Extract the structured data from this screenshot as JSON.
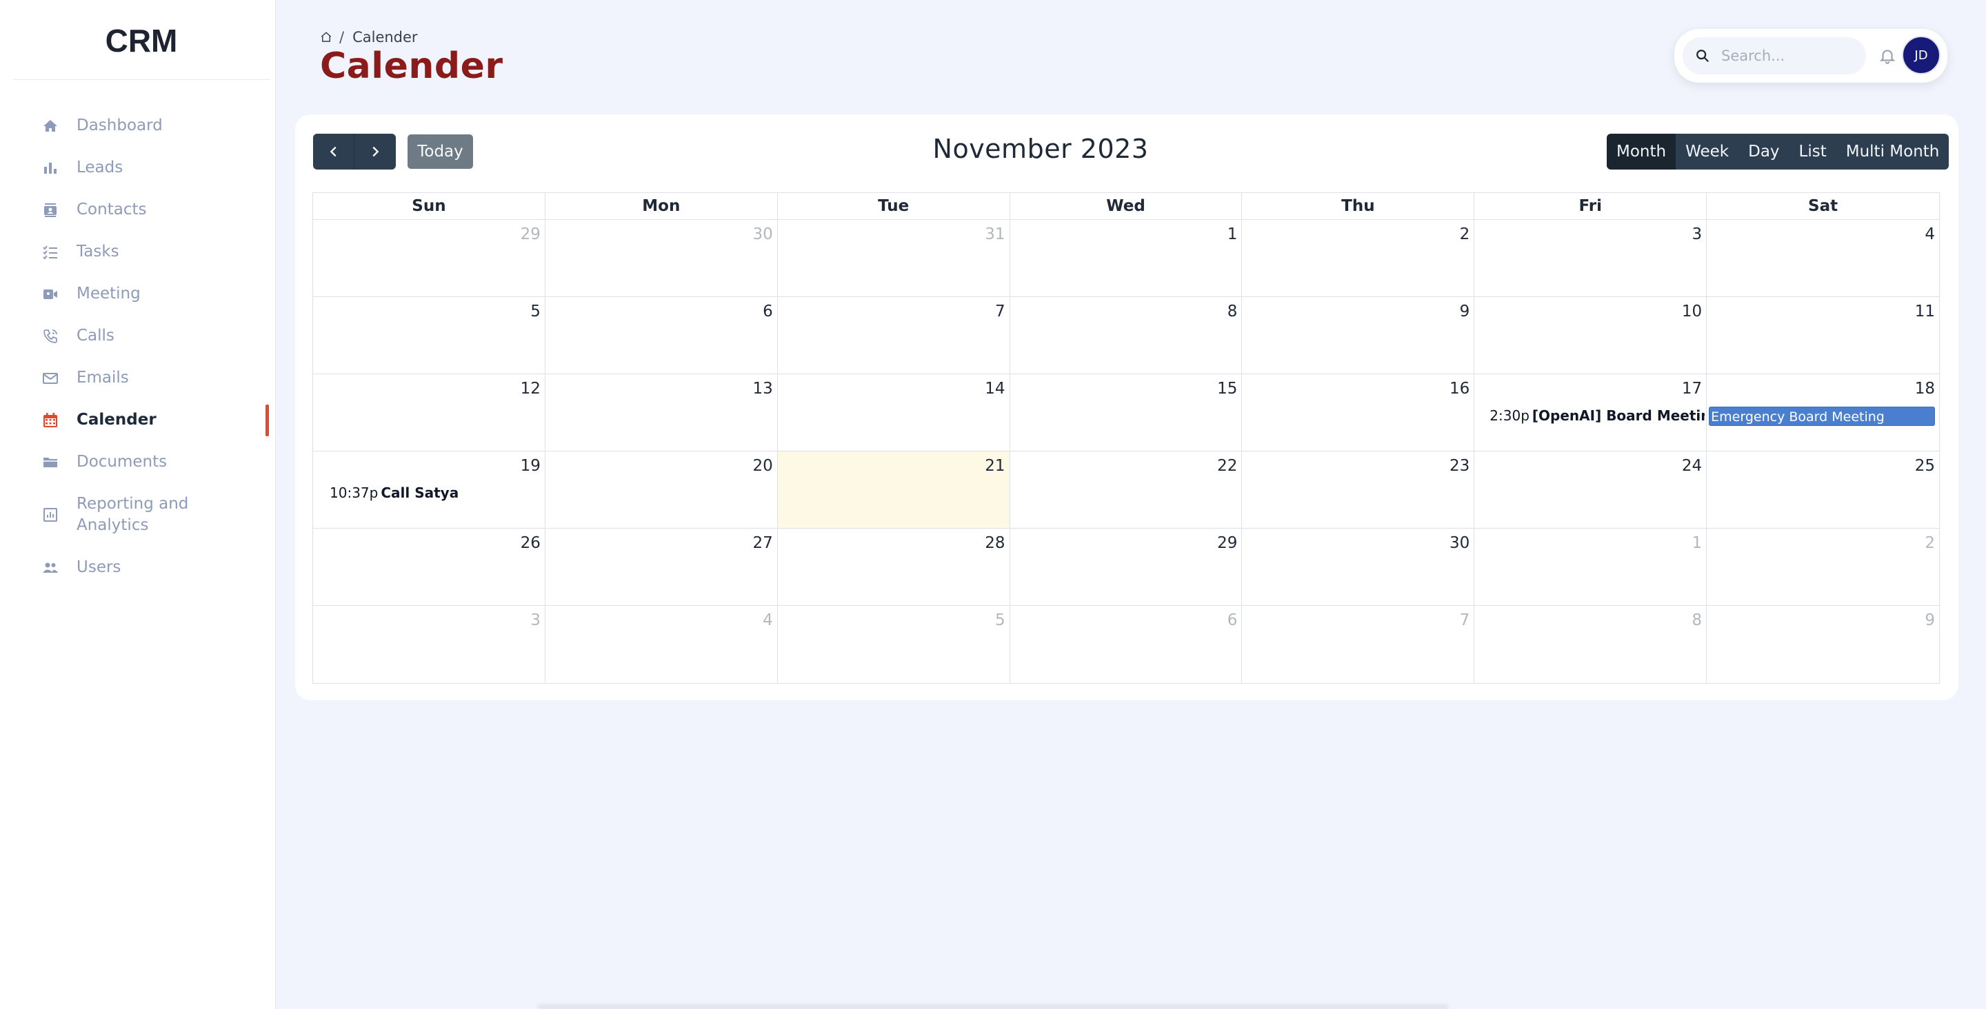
{
  "app": {
    "logo": "CRM"
  },
  "sidebar": {
    "items": [
      {
        "label": "Dashboard",
        "icon": "home-icon",
        "active": false
      },
      {
        "label": "Leads",
        "icon": "bar-chart-icon",
        "active": false
      },
      {
        "label": "Contacts",
        "icon": "contact-card-icon",
        "active": false
      },
      {
        "label": "Tasks",
        "icon": "checklist-icon",
        "active": false
      },
      {
        "label": "Meeting",
        "icon": "video-camera-icon",
        "active": false
      },
      {
        "label": "Calls",
        "icon": "phone-icon",
        "active": false
      },
      {
        "label": "Emails",
        "icon": "envelope-icon",
        "active": false
      },
      {
        "label": "Calender",
        "icon": "calendar-icon",
        "active": true
      },
      {
        "label": "Documents",
        "icon": "folder-icon",
        "active": false
      },
      {
        "label": "Reporting and Analytics",
        "icon": "report-icon",
        "active": false
      },
      {
        "label": "Users",
        "icon": "users-icon",
        "active": false
      }
    ]
  },
  "header": {
    "breadcrumb": {
      "separator": "/",
      "current": "Calender"
    },
    "title": "Calender",
    "search": {
      "placeholder": "Search..."
    },
    "avatar": {
      "initials": "JD"
    }
  },
  "calendar": {
    "today_label": "Today",
    "title": "November 2023",
    "views": [
      {
        "label": "Month",
        "active": true
      },
      {
        "label": "Week",
        "active": false
      },
      {
        "label": "Day",
        "active": false
      },
      {
        "label": "List",
        "active": false
      },
      {
        "label": "Multi Month",
        "active": false
      }
    ],
    "days_of_week": [
      "Sun",
      "Mon",
      "Tue",
      "Wed",
      "Thu",
      "Fri",
      "Sat"
    ],
    "weeks": [
      [
        {
          "d": "29",
          "other": true
        },
        {
          "d": "30",
          "other": true
        },
        {
          "d": "31",
          "other": true
        },
        {
          "d": "1"
        },
        {
          "d": "2"
        },
        {
          "d": "3"
        },
        {
          "d": "4"
        }
      ],
      [
        {
          "d": "5"
        },
        {
          "d": "6"
        },
        {
          "d": "7"
        },
        {
          "d": "8"
        },
        {
          "d": "9"
        },
        {
          "d": "10"
        },
        {
          "d": "11"
        }
      ],
      [
        {
          "d": "12"
        },
        {
          "d": "13"
        },
        {
          "d": "14"
        },
        {
          "d": "15"
        },
        {
          "d": "16"
        },
        {
          "d": "17",
          "event": {
            "time": "2:30p",
            "title": "[OpenAI] Board Meeting",
            "style": "dot"
          }
        },
        {
          "d": "18",
          "event": {
            "title": "Emergency Board Meeting",
            "style": "block"
          }
        }
      ],
      [
        {
          "d": "19",
          "event": {
            "time": "10:37p",
            "title": "Call Satya",
            "style": "dot"
          }
        },
        {
          "d": "20"
        },
        {
          "d": "21",
          "today": true
        },
        {
          "d": "22"
        },
        {
          "d": "23"
        },
        {
          "d": "24"
        },
        {
          "d": "25"
        }
      ],
      [
        {
          "d": "26"
        },
        {
          "d": "27"
        },
        {
          "d": "28"
        },
        {
          "d": "29"
        },
        {
          "d": "30"
        },
        {
          "d": "1",
          "other": true
        },
        {
          "d": "2",
          "other": true
        }
      ],
      [
        {
          "d": "3",
          "other": true
        },
        {
          "d": "4",
          "other": true
        },
        {
          "d": "5",
          "other": true
        },
        {
          "d": "6",
          "other": true
        },
        {
          "d": "7",
          "other": true
        },
        {
          "d": "8",
          "other": true
        },
        {
          "d": "9",
          "other": true
        }
      ]
    ]
  },
  "colors": {
    "accent": "#e04a2a",
    "title": "#8b1a1a",
    "button": "#2c3e50",
    "event_block": "#4a7fd0",
    "today_bg": "#fef9e5"
  }
}
